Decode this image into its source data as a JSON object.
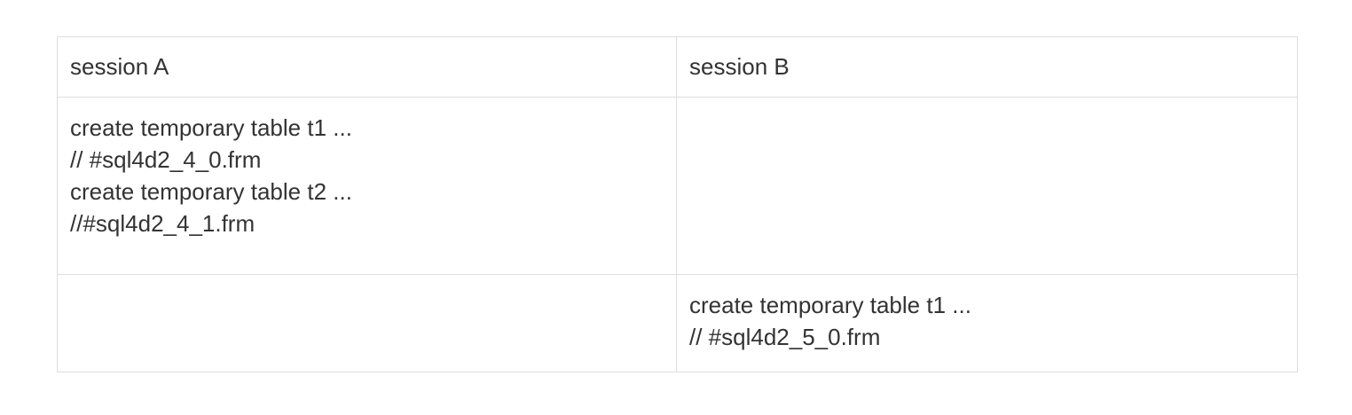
{
  "table": {
    "headers": [
      "session A",
      "session B"
    ],
    "rows": [
      {
        "session_a": [
          "create temporary table t1 ...",
          "// #sql4d2_4_0.frm",
          "create temporary table t2 ...",
          "//#sql4d2_4_1.frm"
        ],
        "session_b": []
      },
      {
        "session_a": [],
        "session_b": [
          "create temporary table t1 ...",
          "// #sql4d2_5_0.frm"
        ]
      }
    ]
  }
}
